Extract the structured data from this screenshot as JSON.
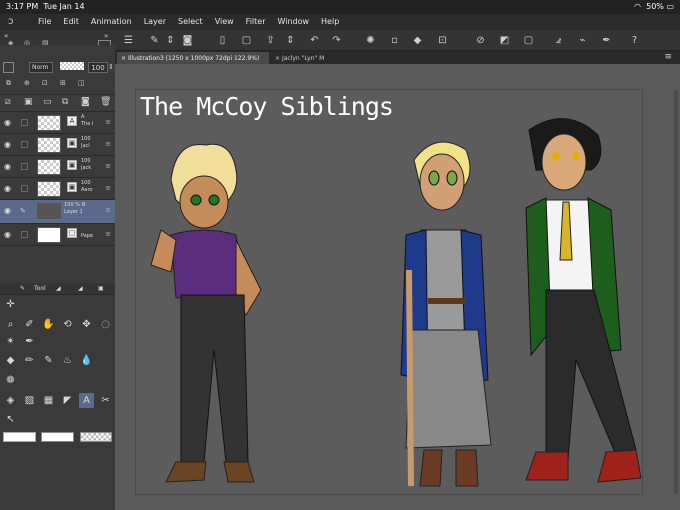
{
  "status_bar": {
    "time": "3:17 PM",
    "date": "Tue Jan 14",
    "battery": "50%"
  },
  "menu": {
    "items": [
      "File",
      "Edit",
      "Animation",
      "Layer",
      "Select",
      "View",
      "Filter",
      "Window",
      "Help"
    ]
  },
  "layer_panel": {
    "blend_mode": "Norm",
    "opacity": "100",
    "layers": [
      {
        "info1": "A",
        "info2": "The I",
        "thumb": "check",
        "kind": "A"
      },
      {
        "info1": "100",
        "info2": "Jacl",
        "thumb": "fig",
        "kind": "▣"
      },
      {
        "info1": "100",
        "info2": "Jack",
        "thumb": "fig",
        "kind": "▣"
      },
      {
        "info1": "100",
        "info2": "Aaro",
        "thumb": "fig",
        "kind": "▣"
      },
      {
        "info1": "100 % N",
        "info2": "Layer 1",
        "thumb": "dark",
        "kind": ""
      },
      {
        "info1": "",
        "info2": "Pape",
        "thumb": "white",
        "kind": "▢"
      }
    ]
  },
  "tool_panel": {
    "tab_label": "Tool"
  },
  "tabs": [
    "Illustration3 (1250 x 1000px 72dpi 122.9%)",
    "Jaclyn \"Lyn\" M"
  ],
  "canvas": {
    "title": "The McCoy Siblings"
  },
  "colors": {
    "accent": "#5a6a8a",
    "canvas_bg": "#5c5c5c"
  }
}
